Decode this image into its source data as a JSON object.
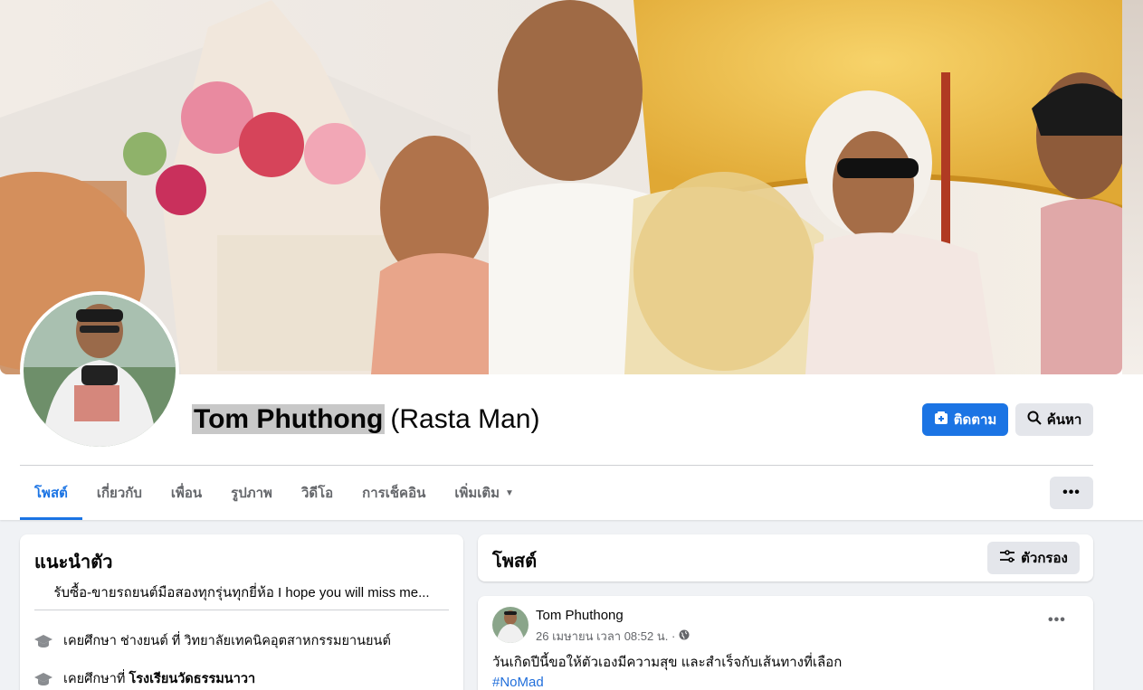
{
  "profile": {
    "name": "Tom Phuthong",
    "alt_name": "(Rasta Man)",
    "follow_label": "ติดตาม",
    "search_label": "ค้นหา"
  },
  "tabs": [
    {
      "label": "โพสต์",
      "active": true
    },
    {
      "label": "เกี่ยวกับ"
    },
    {
      "label": "เพื่อน"
    },
    {
      "label": "รูปภาพ"
    },
    {
      "label": "วิดีโอ"
    },
    {
      "label": "การเช็คอิน"
    },
    {
      "label": "เพิ่มเติม"
    }
  ],
  "more_button": "•••",
  "intro": {
    "title": "แนะนำตัว",
    "bio": "รับซื้อ-ขายรถยนต์มือสองทุกรุ่นทุกยี่ห้อ I hope you will miss me...",
    "education": [
      {
        "prefix": "เคยศึกษา ช่างยนต์ ที่ วิทยาลัยเทคนิคอุตสาหกรรมยานยนต์",
        "school": ""
      },
      {
        "prefix": "เคยศึกษาที่ ",
        "school": "โรงเรียนวัดธรรมนาวา"
      }
    ]
  },
  "posts_section": {
    "title": "โพสต์",
    "filter_label": "ตัวกรอง"
  },
  "post": {
    "author": "Tom Phuthong",
    "meta": "26 เมษายน เวลา 08:52 น. ·",
    "text": "วันเกิดปีนี้ขอให้ตัวเองมีความสุข และสำเร็จกับเส้นทางที่เลือก",
    "hashtag": "#NoMad",
    "menu": "•••"
  },
  "colors": {
    "accent": "#1b74e4",
    "background": "#f0f2f5",
    "button_gray": "#e4e6eb",
    "link": "#216fdb"
  }
}
